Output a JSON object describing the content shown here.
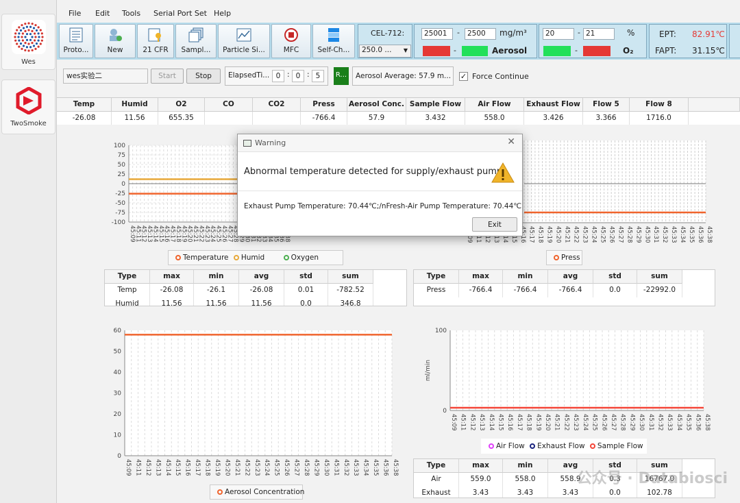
{
  "nav": [
    {
      "label": "Wes"
    },
    {
      "label": "TwoSmoke"
    }
  ],
  "menu": [
    "File",
    "Edit",
    "Tools",
    "Serial Port Set",
    "Help"
  ],
  "toolbar": [
    "Proto...",
    "New",
    "21 CFR",
    "Sampl...",
    "Particle Si...",
    "MFC",
    "Self-Ch..."
  ],
  "cel": {
    "label": "CEL-712:",
    "value": "250.0 ..."
  },
  "aerosol": {
    "low": "25001",
    "high": "2500",
    "unit": "mg/m³",
    "label": "Aerosol"
  },
  "oxygen": {
    "low": "20",
    "high": "21",
    "unit": "%",
    "label": "O₂"
  },
  "ept": {
    "label": "EPT:",
    "value": "82.91℃",
    "fapt_label": "FAPT:",
    "fapt_value": "31.15℃"
  },
  "controls": {
    "experiment": "wes实验二",
    "start": "Start",
    "stop": "Stop",
    "elapsed_label": "ElapsedTi...",
    "h": "0",
    "m": "0",
    "s": "5",
    "r_label": "R...",
    "aerosol_avg": "Aerosol Average:  57.9 m...",
    "force": "Force Continue"
  },
  "table": {
    "headers": [
      "Temp",
      "Humid",
      "O2",
      "CO",
      "CO2",
      "Press",
      "Aerosol Conc.",
      "Sample Flow",
      "Air Flow",
      "Exhaust Flow",
      "Flow 5",
      "Flow 8"
    ],
    "values": [
      "-26.08",
      "11.56",
      "655.35",
      "",
      "",
      "-766.4",
      "57.9",
      "3.432",
      "558.0",
      "3.426",
      "3.366",
      "1716.0"
    ]
  },
  "colors": {
    "temp": "#f0642d",
    "humid": "#e8a93a",
    "oxygen": "#4caf50",
    "press": "#f0642d",
    "air": "#e040fb",
    "exhaust": "#1a237e",
    "sample": "#f44336",
    "red": "#e53935",
    "green": "#22e05a"
  },
  "chart_data": [
    {
      "type": "line",
      "title": "",
      "ylim": [
        -100,
        100
      ],
      "yticks": [
        "100",
        "75",
        "50",
        "25",
        "0",
        "-25",
        "-50",
        "-75",
        "-100"
      ],
      "x": [
        "45:09",
        "45:11",
        "45:12",
        "45:13",
        "45:14",
        "45:15",
        "45:16",
        "45:17",
        "45:18",
        "45:19",
        "45:20",
        "45:21",
        "45:22",
        "45:23",
        "45:24",
        "45:25",
        "45:26",
        "45:27",
        "45:28",
        "45:29",
        "45:30",
        "45:31",
        "45:32",
        "45:33",
        "45:34",
        "45:35",
        "45:36",
        "45:38"
      ],
      "series": [
        {
          "name": "Temperature",
          "value": -26.08
        },
        {
          "name": "Humid",
          "value": 11.56
        },
        {
          "name": "Oxygen",
          "value": null
        }
      ]
    },
    {
      "type": "line",
      "title": "",
      "x": [
        "45:09",
        "45:11",
        "45:12",
        "45:13",
        "45:14",
        "45:15",
        "45:16",
        "45:17",
        "45:18",
        "45:19",
        "45:20",
        "45:21",
        "45:22",
        "45:23",
        "45:24",
        "45:25",
        "45:26",
        "45:27",
        "45:28",
        "45:29",
        "45:30",
        "45:31",
        "45:32",
        "45:33",
        "45:34",
        "45:35",
        "45:36",
        "45:38"
      ],
      "series": [
        {
          "name": "Press",
          "value": -766.4
        }
      ]
    },
    {
      "type": "line",
      "title": "",
      "ylim": [
        0,
        60
      ],
      "yticks": [
        "60",
        "50",
        "40",
        "30",
        "20",
        "10",
        "0"
      ],
      "x": [
        "45:09",
        "45:11",
        "45:12",
        "45:13",
        "45:14",
        "45:15",
        "45:16",
        "45:17",
        "45:18",
        "45:19",
        "45:20",
        "45:21",
        "45:22",
        "45:23",
        "45:24",
        "45:25",
        "45:26",
        "45:27",
        "45:28",
        "45:29",
        "45:30",
        "45:31",
        "45:32",
        "45:33",
        "45:34",
        "45:35",
        "45:36",
        "45:38"
      ],
      "series": [
        {
          "name": "Aerosol Concentration",
          "value": 57.9
        }
      ]
    },
    {
      "type": "line",
      "title": "",
      "ylabel": "ml/min",
      "ylim": [
        0,
        100
      ],
      "yticks": [
        "100",
        "0"
      ],
      "x": [
        "45:09",
        "45:11",
        "45:12",
        "45:13",
        "45:14",
        "45:15",
        "45:16",
        "45:17",
        "45:18",
        "45:19",
        "45:20",
        "45:21",
        "45:22",
        "45:23",
        "45:24",
        "45:25",
        "45:26",
        "45:27",
        "45:28",
        "45:29",
        "45:30",
        "45:31",
        "45:32",
        "45:33",
        "45:34",
        "45:35",
        "45:36",
        "45:38"
      ],
      "series": [
        {
          "name": "Air Flow",
          "value": null
        },
        {
          "name": "Exhaust Flow",
          "value": null
        },
        {
          "name": "Sample Flow",
          "value": 3.43
        }
      ]
    }
  ],
  "stats1": {
    "headers": [
      "Type",
      "max",
      "min",
      "avg",
      "std",
      "sum"
    ],
    "rows": [
      [
        "Temp",
        "-26.08",
        "-26.1",
        "-26.08",
        "0.01",
        "-782.52"
      ],
      [
        "Humid",
        "11.56",
        "11.56",
        "11.56",
        "0.0",
        "346.8"
      ]
    ]
  },
  "stats2": {
    "headers": [
      "Type",
      "max",
      "min",
      "avg",
      "std",
      "sum"
    ],
    "rows": [
      [
        "Press",
        "-766.4",
        "-766.4",
        "-766.4",
        "0.0",
        "-22992.0"
      ]
    ]
  },
  "stats3": {
    "headers": [
      "Type",
      "max",
      "min",
      "avg",
      "std",
      "sum"
    ],
    "rows": [
      [
        "Air",
        "559.0",
        "558.0",
        "558.9",
        "0.3",
        "16767.0"
      ],
      [
        "Exhaust",
        "3.43",
        "3.43",
        "3.43",
        "0.0",
        "102.78"
      ]
    ]
  },
  "dialog": {
    "title": "Warning",
    "message": "Abnormal temperature detected for supply/exhaust pump.",
    "detail": "Exhaust Pump Temperature: 70.44℃;/nFresh-Air Pump Temperature: 70.44℃",
    "exit": "Exit"
  },
  "watermark": "公众号 · Databiosci"
}
